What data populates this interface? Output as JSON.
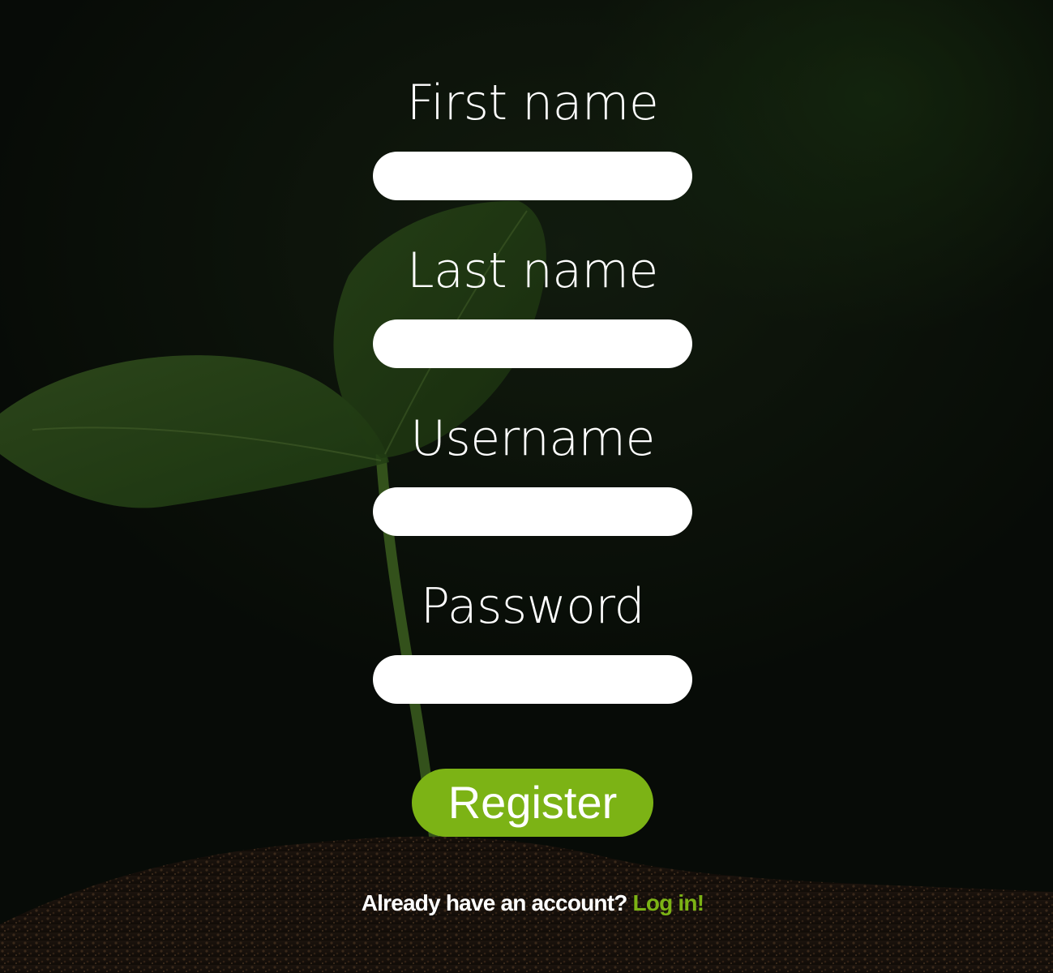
{
  "form": {
    "fields": [
      {
        "label": "First name",
        "value": ""
      },
      {
        "label": "Last name",
        "value": ""
      },
      {
        "label": "Username",
        "value": ""
      },
      {
        "label": "Password",
        "value": ""
      }
    ],
    "submit_label": "Register",
    "login_prompt": "Already have an account?",
    "login_link": "Log in!"
  },
  "colors": {
    "accent": "#7cb315",
    "input_bg": "#ffffff",
    "text": "#ffffff",
    "background": "#0d130c"
  }
}
